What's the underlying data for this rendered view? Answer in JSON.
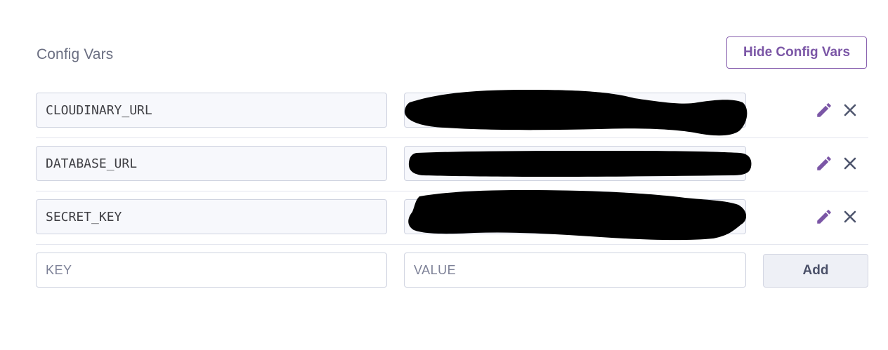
{
  "section": {
    "title": "Config Vars",
    "toggle_label": "Hide Config Vars"
  },
  "config_vars": [
    {
      "key": "CLOUDINARY_URL",
      "value_redacted": true
    },
    {
      "key": "DATABASE_URL",
      "value_redacted": true
    },
    {
      "key": "SECRET_KEY",
      "value_redacted": true
    }
  ],
  "new_var": {
    "key_placeholder": "KEY",
    "value_placeholder": "VALUE",
    "add_label": "Add"
  },
  "icons": {
    "edit": "pencil-icon",
    "delete": "close-icon"
  },
  "colors": {
    "accent": "#7b56a6",
    "title": "#6b6f82",
    "field_bg": "#f7f8fc",
    "border": "#cfd3e0",
    "redaction": "#000000"
  }
}
